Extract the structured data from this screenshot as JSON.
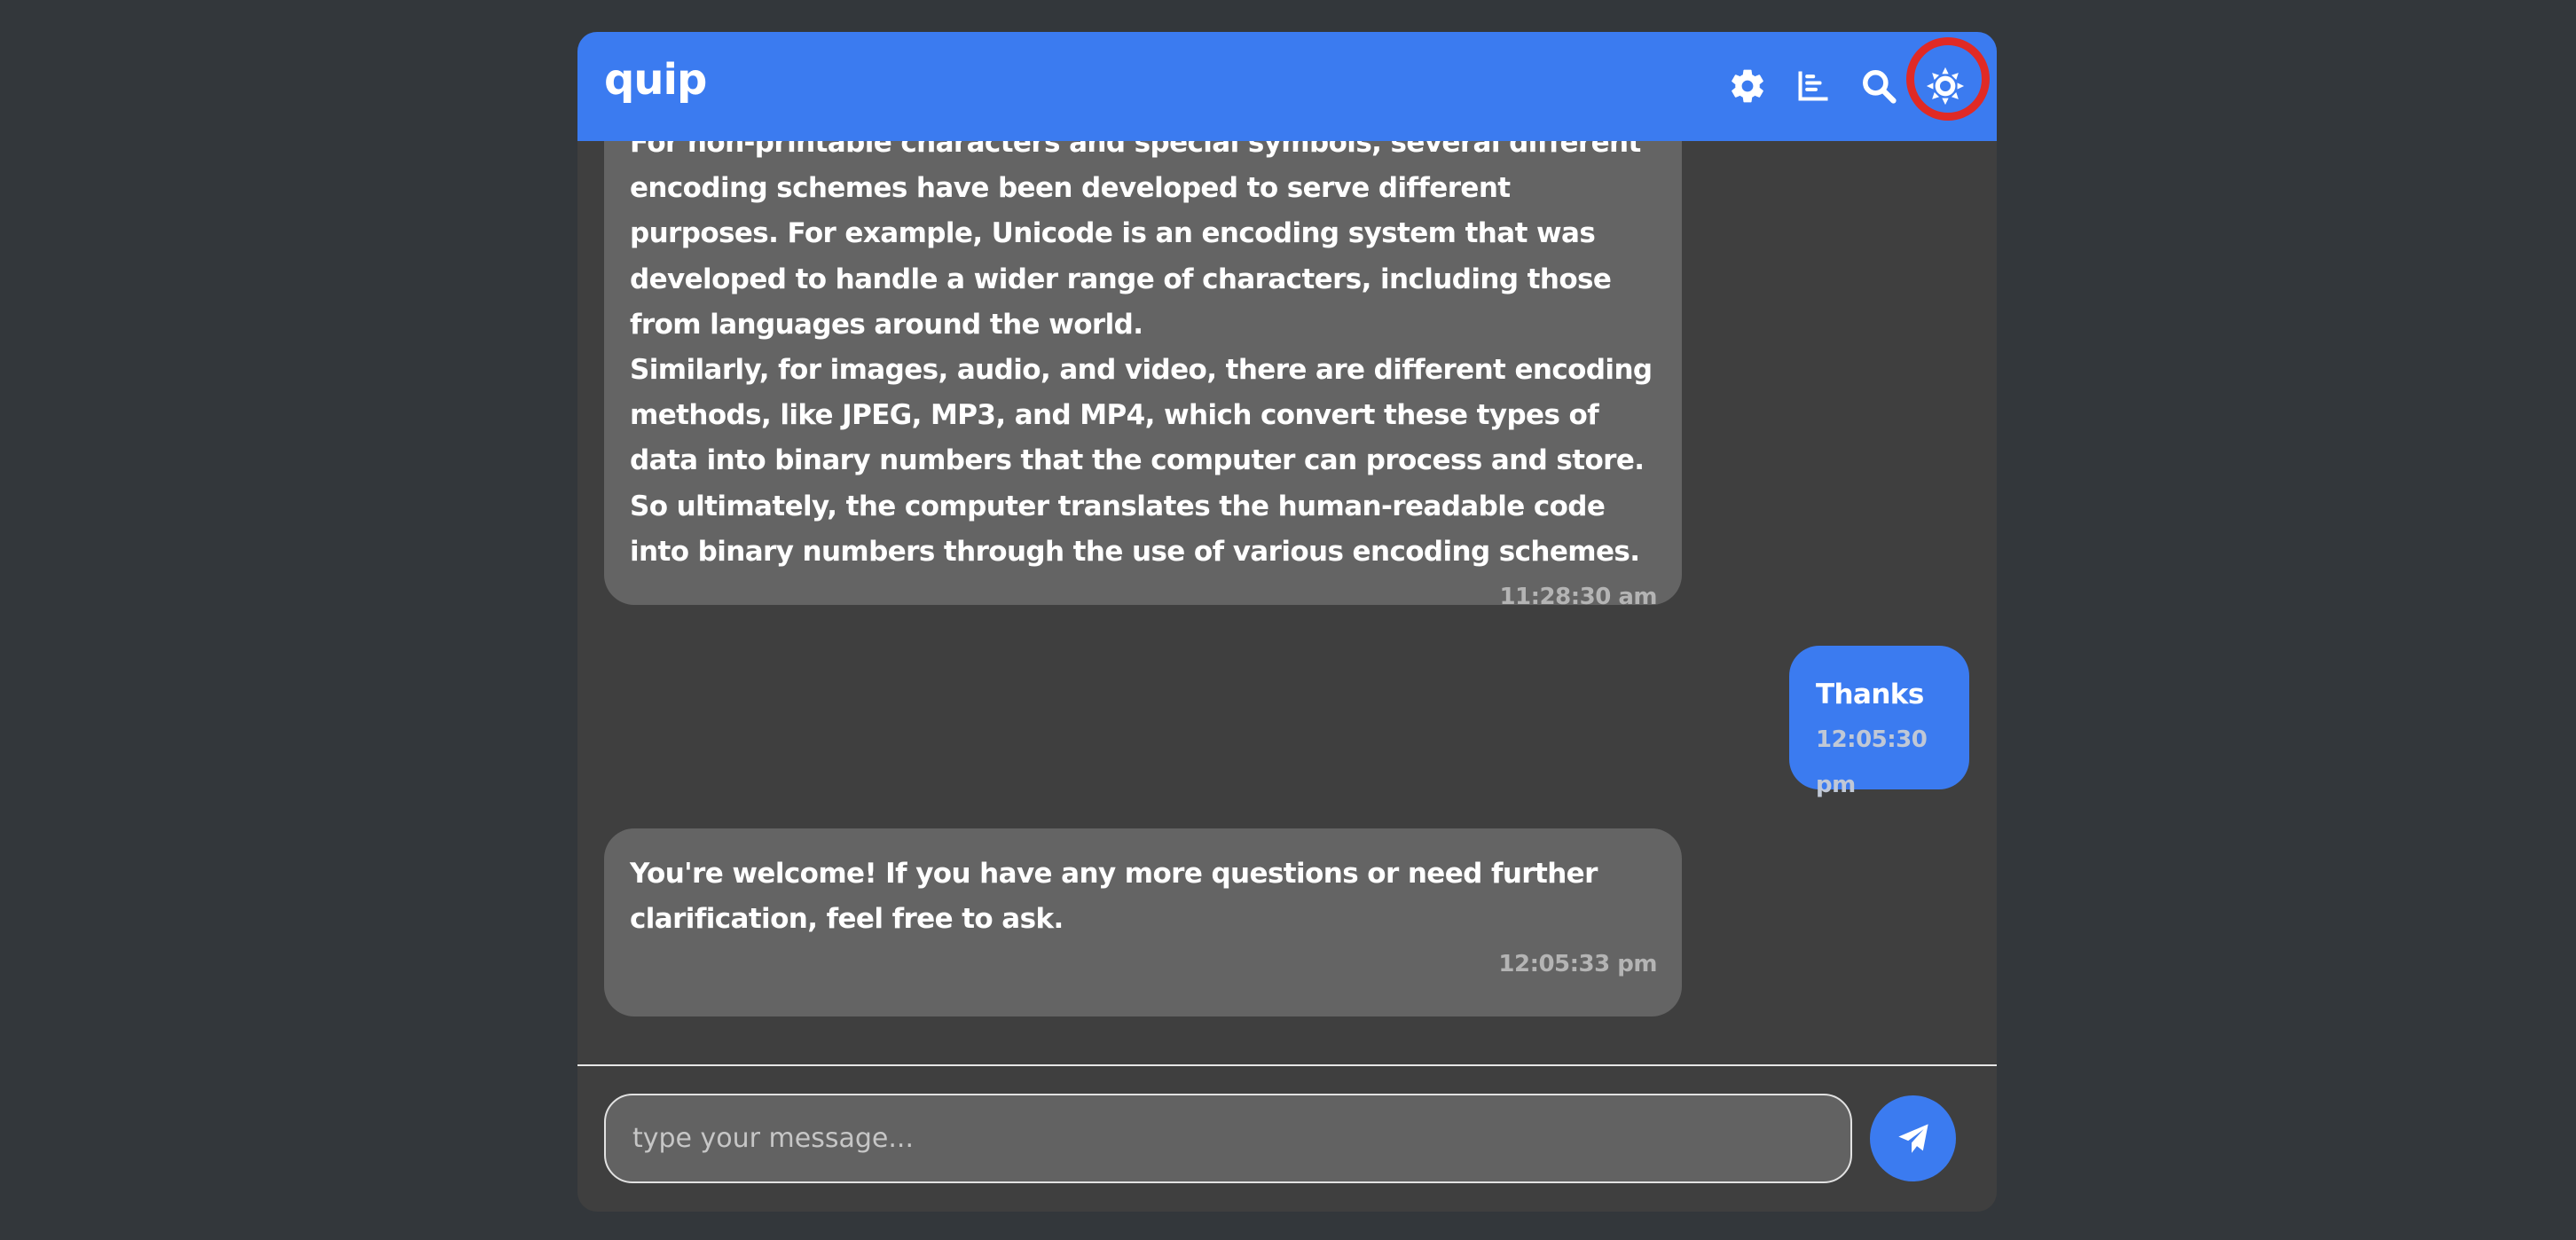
{
  "app": {
    "brand": "quip"
  },
  "header": {
    "icons": [
      "gear-icon",
      "bar-chart-icon",
      "search-icon",
      "sun-icon"
    ],
    "highlighted_icon": "sun-icon",
    "accent_color": "#3b7bf0",
    "highlight_color": "#e02a25"
  },
  "messages": [
    {
      "role": "bot",
      "paragraphs": [
        "For non-printable characters and special symbols, several different encoding schemes have been developed to serve different purposes. For example, Unicode is an encoding system that was developed to handle a wider range of characters, including those from languages around the world.",
        "Similarly, for images, audio, and video, there are different encoding methods, like JPEG, MP3, and MP4, which convert these types of data into binary numbers that the computer can process and store.",
        "So ultimately, the computer translates the human-readable code into binary numbers through the use of various encoding schemes."
      ],
      "time": "11:28:30 am"
    },
    {
      "role": "user",
      "paragraphs": [
        "Thanks"
      ],
      "time": "12:05:30 pm"
    },
    {
      "role": "bot",
      "paragraphs": [
        "You're welcome! If you have any more questions or need further clarification, feel free to ask."
      ],
      "time": "12:05:33 pm"
    }
  ],
  "composer": {
    "placeholder": "type your message...",
    "value": "",
    "send_icon": "paper-plane-icon"
  }
}
